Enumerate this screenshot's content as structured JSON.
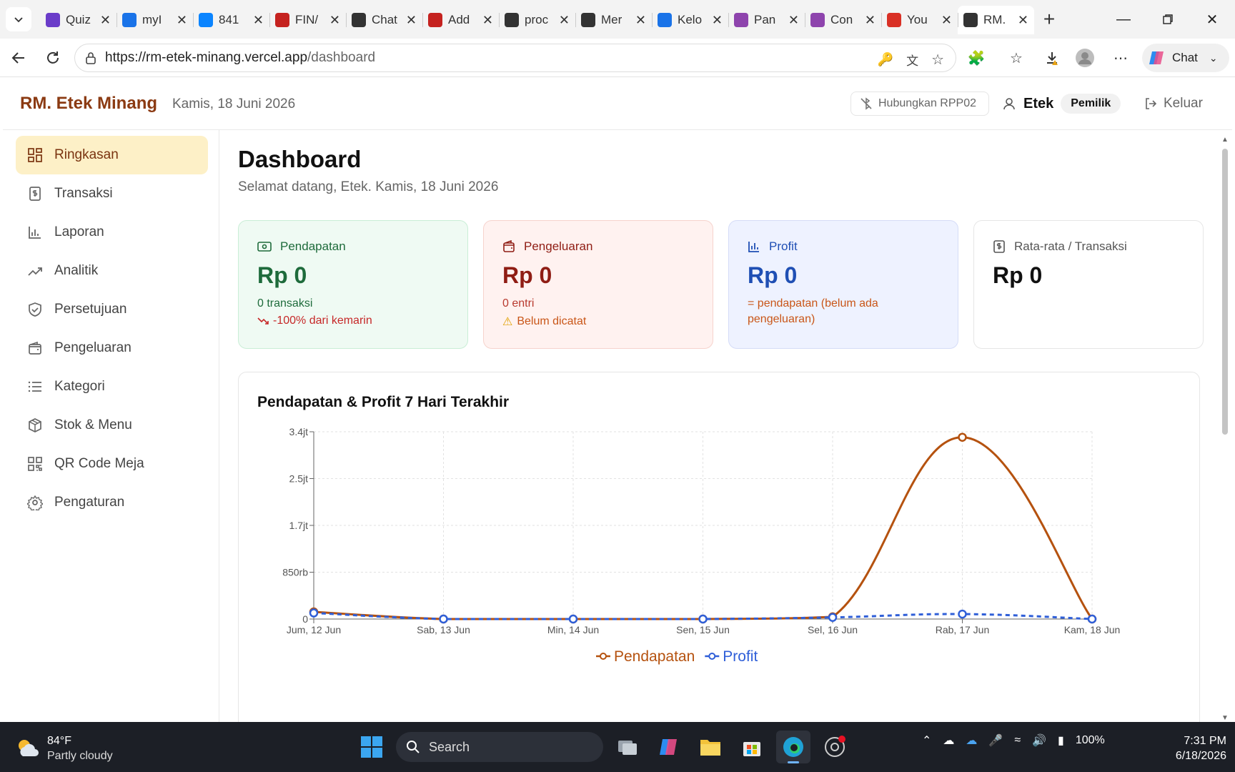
{
  "browser": {
    "tabs": [
      {
        "title": "Quiz",
        "icon": "quizizz-icon",
        "color": "#6a3cc9"
      },
      {
        "title": "myI",
        "icon": "globe-blue-icon",
        "color": "#1a73e8"
      },
      {
        "title": "841",
        "icon": "edge-doc-icon",
        "color": "#0a84ff"
      },
      {
        "title": "FIN/",
        "icon": "pdf-icon",
        "color": "#c5221f"
      },
      {
        "title": "Chat",
        "icon": "chatgpt-icon",
        "color": "#333333"
      },
      {
        "title": "Add",
        "icon": "github-icon",
        "color": "#c5221f"
      },
      {
        "title": "proc",
        "icon": "globe-icon",
        "color": "#333333"
      },
      {
        "title": "Mer",
        "icon": "github-icon",
        "color": "#333333"
      },
      {
        "title": "Kelo",
        "icon": "google-docs-icon",
        "color": "#1a73e8"
      },
      {
        "title": "Pan",
        "icon": "gamma-icon",
        "color": "#8e44ad"
      },
      {
        "title": "Con",
        "icon": "gamma-icon",
        "color": "#8e44ad"
      },
      {
        "title": "You",
        "icon": "gmail-icon",
        "color": "#d93025"
      },
      {
        "title": "RM.",
        "icon": "globe-icon",
        "color": "#333333",
        "active": true
      }
    ],
    "url_host": "https://rm-etek-minang.vercel.app",
    "url_path": "/dashboard",
    "copilot_label": "Chat"
  },
  "header": {
    "brand": "RM. Etek Minang",
    "date": "Kamis, 18 Juni 2026",
    "printer_label": "Hubungkan RPP02",
    "user_name": "Etek",
    "role": "Pemilik",
    "logout_label": "Keluar"
  },
  "sidebar": {
    "items": [
      {
        "label": "Ringkasan",
        "icon": "dashboard-grid-icon",
        "active": true
      },
      {
        "label": "Transaksi",
        "icon": "receipt-icon"
      },
      {
        "label": "Laporan",
        "icon": "bar-chart-icon"
      },
      {
        "label": "Analitik",
        "icon": "trending-up-icon"
      },
      {
        "label": "Persetujuan",
        "icon": "shield-check-icon"
      },
      {
        "label": "Pengeluaran",
        "icon": "wallet-icon"
      },
      {
        "label": "Kategori",
        "icon": "list-icon"
      },
      {
        "label": "Stok & Menu",
        "icon": "package-icon"
      },
      {
        "label": "QR Code Meja",
        "icon": "qr-code-icon"
      },
      {
        "label": "Pengaturan",
        "icon": "gear-icon"
      }
    ]
  },
  "main": {
    "title": "Dashboard",
    "subtitle": "Selamat datang, Etek. Kamis, 18 Juni 2026",
    "cards": {
      "income": {
        "label": "Pendapatan",
        "value": "Rp 0",
        "line1": "0 transaksi",
        "line2": "-100% dari kemarin"
      },
      "expense": {
        "label": "Pengeluaran",
        "value": "Rp 0",
        "line1": "0 entri",
        "line2": "Belum dicatat"
      },
      "profit": {
        "label": "Profit",
        "value": "Rp 0",
        "line1": "= pendapatan (belum ada pengeluaran)"
      },
      "avg": {
        "label": "Rata-rata / Transaksi",
        "value": "Rp 0"
      }
    },
    "chart_title": "Pendapatan & Profit 7 Hari Terakhir"
  },
  "chart_data": {
    "type": "line",
    "title": "Pendapatan & Profit 7 Hari Terakhir",
    "categories": [
      "Jum, 12 Jun",
      "Sab, 13 Jun",
      "Min, 14 Jun",
      "Sen, 15 Jun",
      "Sel, 16 Jun",
      "Rab, 17 Jun",
      "Kam, 18 Jun"
    ],
    "y_ticks": [
      {
        "value": 0,
        "label": "0"
      },
      {
        "value": 850000,
        "label": "850rb"
      },
      {
        "value": 1700000,
        "label": "1.7jt"
      },
      {
        "value": 2550000,
        "label": "2.5jt"
      },
      {
        "value": 3400000,
        "label": "3.4jt"
      }
    ],
    "ylim": [
      0,
      3400000
    ],
    "grid": true,
    "legend_position": "bottom-center",
    "series": [
      {
        "name": "Pendapatan",
        "color": "#b5520f",
        "dashed": false,
        "values": [
          130000,
          0,
          0,
          0,
          40000,
          3300000,
          0
        ]
      },
      {
        "name": "Profit",
        "color": "#2f5fd8",
        "dashed": true,
        "values": [
          110000,
          0,
          0,
          0,
          30000,
          90000,
          0
        ]
      }
    ]
  },
  "taskbar": {
    "temperature": "84°F",
    "weather": "Partly cloudy",
    "search_placeholder": "Search",
    "battery": "100%",
    "time": "7:31 PM",
    "date": "6/18/2026"
  }
}
